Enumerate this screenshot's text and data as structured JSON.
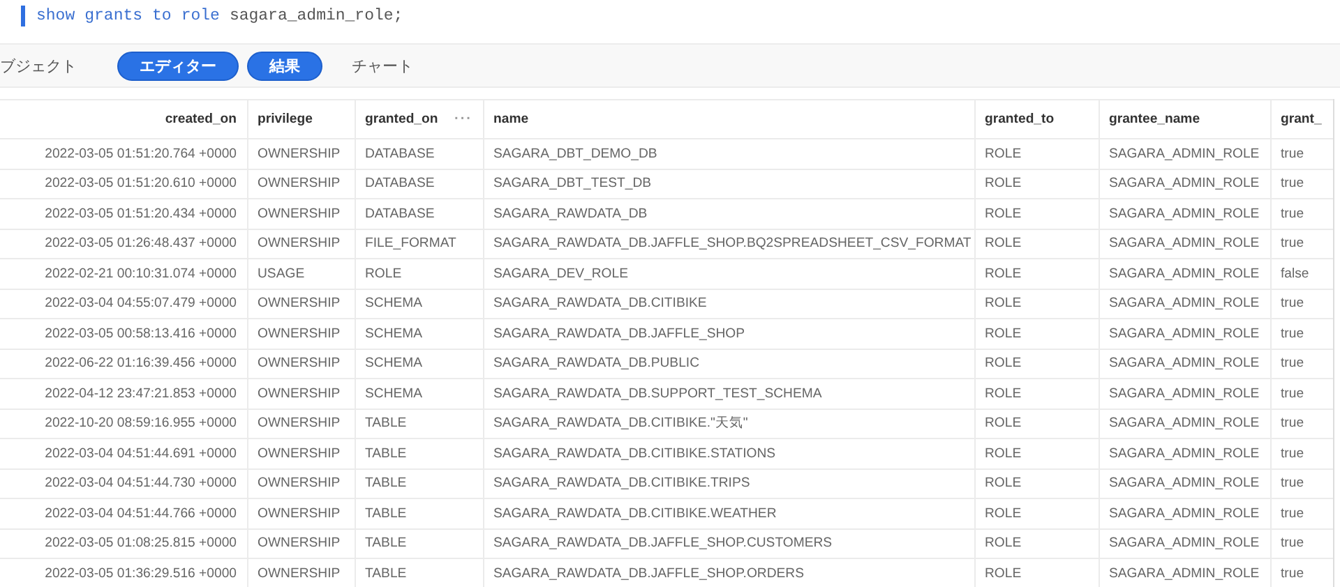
{
  "editor": {
    "code": [
      {
        "kind": "keyword",
        "text": "show"
      },
      {
        "kind": "keyword",
        "text": "grants"
      },
      {
        "kind": "keyword",
        "text": "to"
      },
      {
        "kind": "keyword",
        "text": "role"
      },
      {
        "kind": "plain",
        "text": "sagara_admin_role;"
      }
    ]
  },
  "tabs": [
    {
      "label": "ブジェクト",
      "selected": false
    },
    {
      "label": "エディター",
      "selected": true
    },
    {
      "label": "結果",
      "selected": true
    },
    {
      "label": "チャート",
      "selected": false
    }
  ],
  "table": {
    "columns": [
      {
        "label": "created_on"
      },
      {
        "label": "privilege"
      },
      {
        "label": "granted_on",
        "menu_icon": "···"
      },
      {
        "label": "name"
      },
      {
        "label": "granted_to"
      },
      {
        "label": "grantee_name"
      },
      {
        "label": "grant_"
      }
    ],
    "rows": [
      [
        "2022-03-05 01:51:20.764 +0000",
        "OWNERSHIP",
        "DATABASE",
        "SAGARA_DBT_DEMO_DB",
        "ROLE",
        "SAGARA_ADMIN_ROLE",
        "true"
      ],
      [
        "2022-03-05 01:51:20.610 +0000",
        "OWNERSHIP",
        "DATABASE",
        "SAGARA_DBT_TEST_DB",
        "ROLE",
        "SAGARA_ADMIN_ROLE",
        "true"
      ],
      [
        "2022-03-05 01:51:20.434 +0000",
        "OWNERSHIP",
        "DATABASE",
        "SAGARA_RAWDATA_DB",
        "ROLE",
        "SAGARA_ADMIN_ROLE",
        "true"
      ],
      [
        "2022-03-05 01:26:48.437 +0000",
        "OWNERSHIP",
        "FILE_FORMAT",
        "SAGARA_RAWDATA_DB.JAFFLE_SHOP.BQ2SPREADSHEET_CSV_FORMAT",
        "ROLE",
        "SAGARA_ADMIN_ROLE",
        "true"
      ],
      [
        "2022-02-21 00:10:31.074 +0000",
        "USAGE",
        "ROLE",
        "SAGARA_DEV_ROLE",
        "ROLE",
        "SAGARA_ADMIN_ROLE",
        "false"
      ],
      [
        "2022-03-04 04:55:07.479 +0000",
        "OWNERSHIP",
        "SCHEMA",
        "SAGARA_RAWDATA_DB.CITIBIKE",
        "ROLE",
        "SAGARA_ADMIN_ROLE",
        "true"
      ],
      [
        "2022-03-05 00:58:13.416 +0000",
        "OWNERSHIP",
        "SCHEMA",
        "SAGARA_RAWDATA_DB.JAFFLE_SHOP",
        "ROLE",
        "SAGARA_ADMIN_ROLE",
        "true"
      ],
      [
        "2022-06-22 01:16:39.456 +0000",
        "OWNERSHIP",
        "SCHEMA",
        "SAGARA_RAWDATA_DB.PUBLIC",
        "ROLE",
        "SAGARA_ADMIN_ROLE",
        "true"
      ],
      [
        "2022-04-12 23:47:21.853 +0000",
        "OWNERSHIP",
        "SCHEMA",
        "SAGARA_RAWDATA_DB.SUPPORT_TEST_SCHEMA",
        "ROLE",
        "SAGARA_ADMIN_ROLE",
        "true"
      ],
      [
        "2022-10-20 08:59:16.955 +0000",
        "OWNERSHIP",
        "TABLE",
        "SAGARA_RAWDATA_DB.CITIBIKE.\"天気\"",
        "ROLE",
        "SAGARA_ADMIN_ROLE",
        "true"
      ],
      [
        "2022-03-04 04:51:44.691 +0000",
        "OWNERSHIP",
        "TABLE",
        "SAGARA_RAWDATA_DB.CITIBIKE.STATIONS",
        "ROLE",
        "SAGARA_ADMIN_ROLE",
        "true"
      ],
      [
        "2022-03-04 04:51:44.730 +0000",
        "OWNERSHIP",
        "TABLE",
        "SAGARA_RAWDATA_DB.CITIBIKE.TRIPS",
        "ROLE",
        "SAGARA_ADMIN_ROLE",
        "true"
      ],
      [
        "2022-03-04 04:51:44.766 +0000",
        "OWNERSHIP",
        "TABLE",
        "SAGARA_RAWDATA_DB.CITIBIKE.WEATHER",
        "ROLE",
        "SAGARA_ADMIN_ROLE",
        "true"
      ],
      [
        "2022-03-05 01:08:25.815 +0000",
        "OWNERSHIP",
        "TABLE",
        "SAGARA_RAWDATA_DB.JAFFLE_SHOP.CUSTOMERS",
        "ROLE",
        "SAGARA_ADMIN_ROLE",
        "true"
      ],
      [
        "2022-03-05 01:36:29.516 +0000",
        "OWNERSHIP",
        "TABLE",
        "SAGARA_RAWDATA_DB.JAFFLE_SHOP.ORDERS",
        "ROLE",
        "SAGARA_ADMIN_ROLE",
        "true"
      ]
    ]
  }
}
